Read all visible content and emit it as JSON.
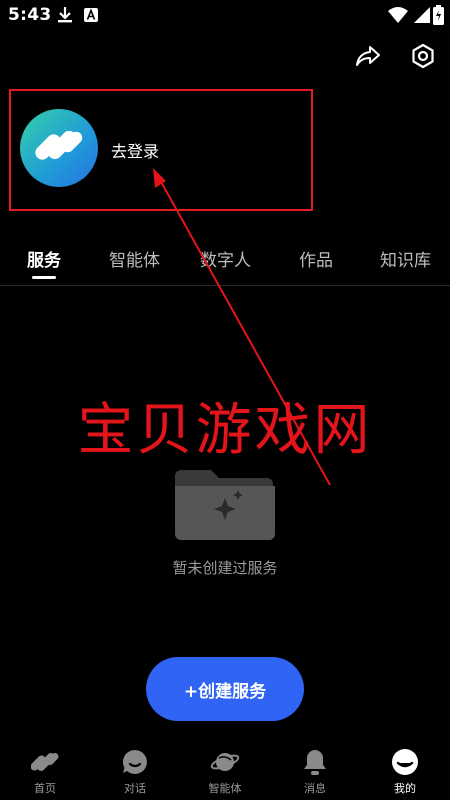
{
  "status_bar": {
    "time": "5:43",
    "icons": [
      "download-icon",
      "a-badge-icon",
      "wifi-icon",
      "battery-icon"
    ]
  },
  "top_actions": {
    "icons": [
      "share-icon",
      "settings-icon"
    ]
  },
  "profile": {
    "login_label": "去登录"
  },
  "tabs": [
    {
      "label": "服务",
      "active": true
    },
    {
      "label": "智能体",
      "active": false
    },
    {
      "label": "数字人",
      "active": false
    },
    {
      "label": "作品",
      "active": false
    },
    {
      "label": "知识库",
      "active": false
    }
  ],
  "watermark": "宝贝游戏网",
  "empty_state": {
    "message": "暂未创建过服务"
  },
  "create_button": {
    "label": "+创建服务"
  },
  "bottom_nav": [
    {
      "label": "首页",
      "icon": "home-logo-icon",
      "active": false
    },
    {
      "label": "对话",
      "icon": "chat-icon",
      "active": false
    },
    {
      "label": "智能体",
      "icon": "planet-icon",
      "active": false
    },
    {
      "label": "消息",
      "icon": "bell-icon",
      "active": false
    },
    {
      "label": "我的",
      "icon": "profile-icon",
      "active": true
    }
  ],
  "colors": {
    "background": "#000000",
    "accent": "#2f64f5",
    "highlight": "#e21b25"
  }
}
